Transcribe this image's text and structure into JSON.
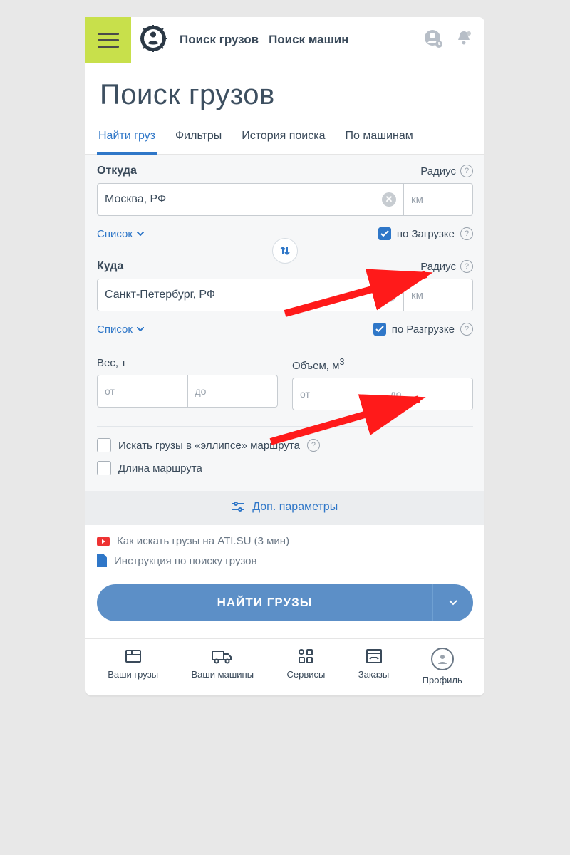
{
  "header": {
    "nav_loads": "Поиск грузов",
    "nav_trucks": "Поиск машин"
  },
  "title": "Поиск грузов",
  "tabs": {
    "find": "Найти груз",
    "filters": "Фильтры",
    "history": "История поиска",
    "by_trucks": "По машинам"
  },
  "form": {
    "from_label": "Откуда",
    "radius_label": "Радиус",
    "from_value": "Москва, РФ",
    "km": "км",
    "list_link": "Список",
    "by_loading": "по Загрузке",
    "to_label": "Куда",
    "to_value": "Санкт-Петербург, РФ",
    "by_unloading": "по Разгрузке",
    "weight_label": "Вес, т",
    "volume_label": "Объем, м",
    "ph_from": "от",
    "ph_to": "до",
    "ellipse": "Искать грузы в «эллипсе» маршрута",
    "route_len": "Длина маршрута",
    "extra": "Доп. параметры"
  },
  "links": {
    "video": "Как искать грузы на ATI.SU (3 мин)",
    "manual": "Инструкция по поиску грузов"
  },
  "cta": "НАЙТИ ГРУЗЫ",
  "bottom": {
    "loads": "Ваши грузы",
    "trucks": "Ваши машины",
    "services": "Сервисы",
    "orders": "Заказы",
    "profile": "Профиль"
  }
}
